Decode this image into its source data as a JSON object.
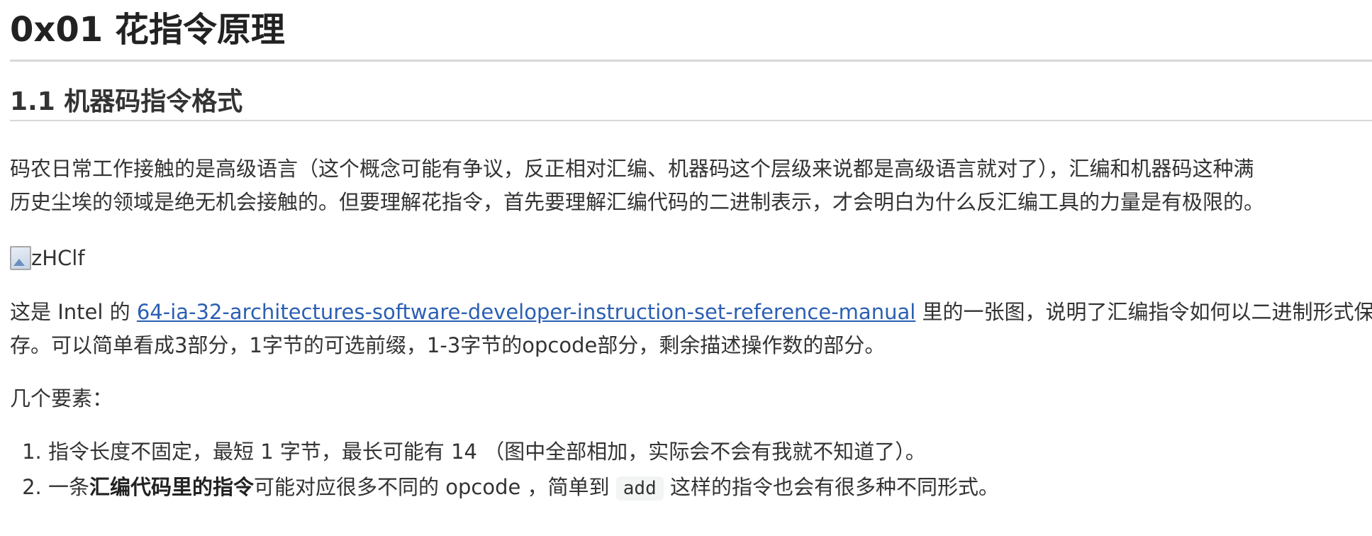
{
  "heading1": "0x01 花指令原理",
  "heading2": "1.1 机器码指令格式",
  "intro": {
    "line1": "码农日常工作接触的是高级语言（这个概念可能有争议，反正相对汇编、机器码这个层级来说都是高级语言就对了），汇编和机器码这种满",
    "line2": "历史尘埃的领域是绝无机会接触的。但要理解花指令，首先要理解汇编代码的二进制表示，才会明白为什么反汇编工具的力量是有极限的。"
  },
  "image": {
    "alt": "zHClf"
  },
  "manual_paragraph": {
    "prefix": "这是 Intel 的 ",
    "link_text": "64-ia-32-architectures-software-developer-instruction-set-reference-manual",
    "suffix": " 里的一张图，说明了汇编指令如何以二进制形式保",
    "line2": "存。可以简单看成3部分，1字节的可选前缀，1-3字节的opcode部分，剩余描述操作数的部分。"
  },
  "elements_intro": "几个要素：",
  "list": {
    "item1": "指令长度不固定，最短 1 字节，最长可能有 14 （图中全部相加，实际会不会有我就不知道了）。",
    "item2_pre": "一条",
    "item2_bold": "汇编代码里的指令",
    "item2_mid": "可能对应很多不同的 opcode ，简单到 ",
    "item2_code": "add",
    "item2_post": " 这样的指令也会有很多种不同形式。"
  }
}
